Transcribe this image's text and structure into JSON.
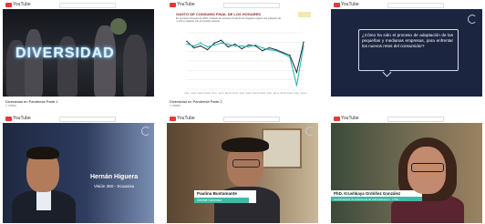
{
  "app": {
    "brand": "YouTube"
  },
  "tiles": [
    {
      "title": "",
      "meta_title": "Diversidad en Pandemia Parte 1",
      "meta_views": "1 vistas",
      "overlay_text": "DIVERSIDAD"
    },
    {
      "meta_title": "Diversidad en Pandemia Parte 2",
      "meta_views": "1 vistas",
      "chart_title": "GASTO DE CONSUMO FINAL DE LOS HOGARES",
      "chart_subtitle": "En el primer trimestre de 2020, el Gasto de Consumo Final de los Hogares registró una variación de -1,2% en relación con el trimestre anterior"
    },
    {
      "question_text": "¿Cómo ha sido el proceso de adaptación de las pequeñas y medianas empresas, para enfrentar los nuevos retos del consumidor?"
    },
    {
      "person_name": "Hernán Higuera",
      "person_role": "Visión 360 - Ecuavisa"
    },
    {
      "person_name": "Paulina Bustamante",
      "person_role": "Gerente Comercial"
    },
    {
      "person_name": "PhD. Krushkaya Ordóñez González",
      "person_role": "Coordinadora de la Escuela de Administración - UTPL"
    }
  ],
  "chart_data": {
    "type": "line",
    "title": "GASTO DE CONSUMO FINAL DE LOS HOGARES",
    "x": [
      "2016.I",
      "2016.II",
      "2016.III",
      "2016.IV",
      "2017.I",
      "2017.II",
      "2017.III",
      "2017.IV",
      "2018.I",
      "2018.II",
      "2018.III",
      "2018.IV",
      "2019.I",
      "2019.II",
      "2019.III",
      "2019.IV",
      "2020.I",
      "2020.II"
    ],
    "series": [
      {
        "values": [
          2.1,
          1.4,
          1.6,
          1.2,
          1.9,
          2.2,
          1.5,
          1.8,
          1.3,
          1.7,
          1.6,
          1.1,
          1.4,
          1.2,
          0.9,
          0.6,
          -1.2,
          2.0
        ]
      },
      {
        "values": [
          1.8,
          1.6,
          1.9,
          1.5,
          1.7,
          1.9,
          1.8,
          1.6,
          1.6,
          1.5,
          1.7,
          1.4,
          1.2,
          1.1,
          0.8,
          0.4,
          -2.6,
          1.6
        ]
      }
    ],
    "ylim": [
      -3,
      3
    ],
    "colors": [
      "#1a2f4d",
      "#22b39f"
    ]
  }
}
